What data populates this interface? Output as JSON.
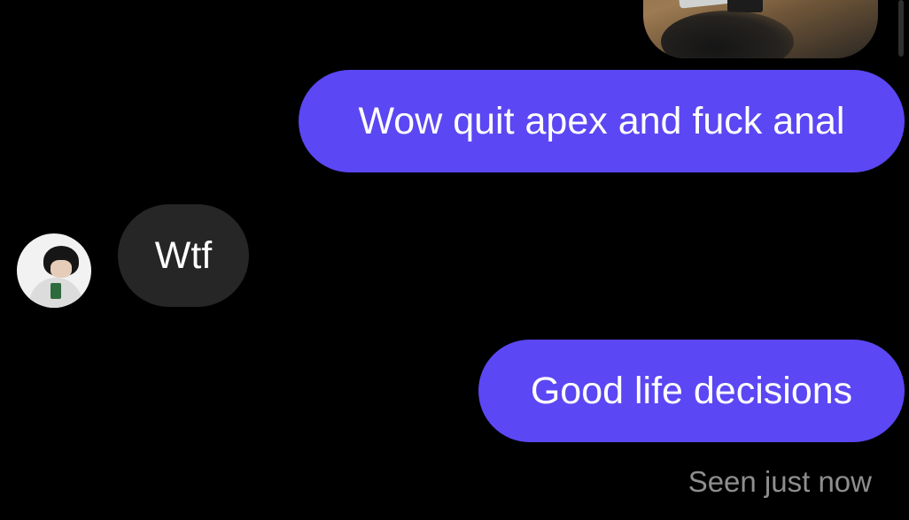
{
  "conversation": {
    "messages": [
      {
        "type": "image",
        "direction": "outgoing",
        "icon": "photo"
      },
      {
        "type": "text",
        "direction": "outgoing",
        "text": "Wow quit apex and fuck anal"
      },
      {
        "type": "text",
        "direction": "incoming",
        "text": "Wtf"
      },
      {
        "type": "text",
        "direction": "outgoing",
        "text": "Good life decisions"
      }
    ],
    "status": "Seen just now"
  },
  "contact": {
    "avatar_icon": "profile-photo"
  },
  "theme": {
    "background": "#000000",
    "outgoing_bubble": "#5b47f3",
    "incoming_bubble": "#262626",
    "text": "#ffffff",
    "status_text": "#8e8e8e"
  }
}
